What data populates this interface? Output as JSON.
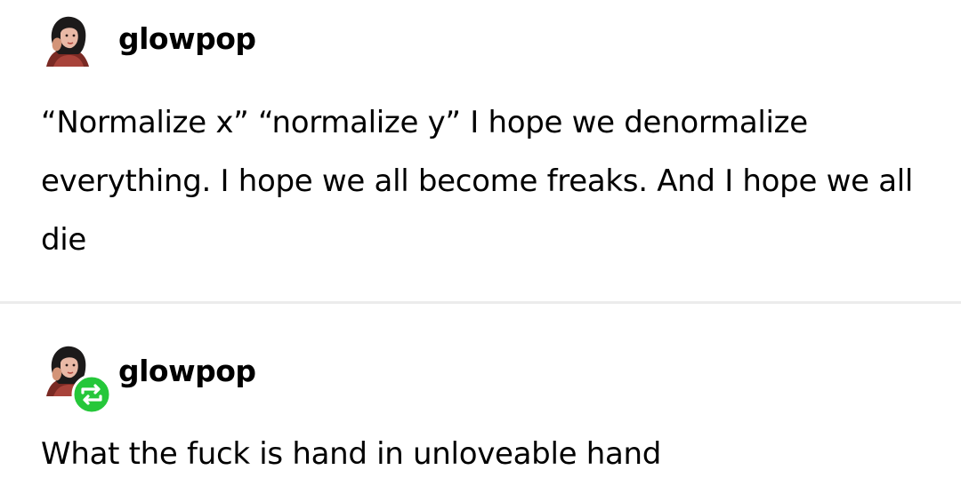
{
  "posts": [
    {
      "username": "glowpop",
      "text": "“Normalize x” “normalize y” I hope we denormalize everything. I hope we all become freaks. And I hope we all die"
    },
    {
      "username": "glowpop",
      "reblog_icon": "reblog-icon",
      "text": "What the fuck is hand in unloveable hand"
    }
  ],
  "colors": {
    "reblog_badge": "#25c73a",
    "divider": "#ececec",
    "text": "#000000"
  }
}
